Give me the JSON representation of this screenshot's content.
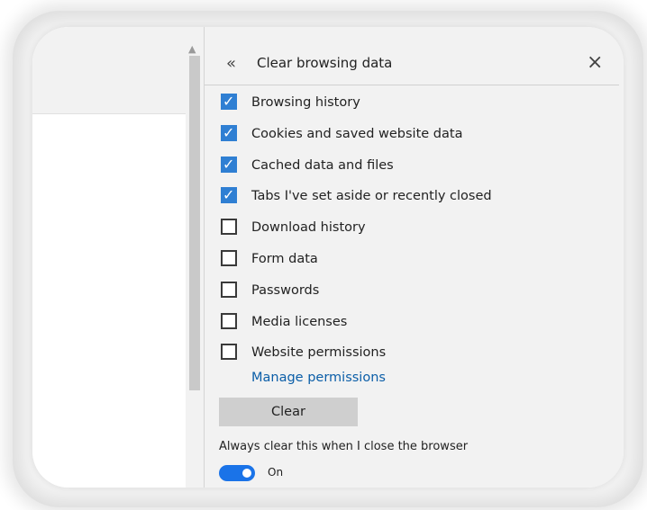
{
  "panel": {
    "title": "Clear browsing data",
    "back_icon": "«",
    "close_icon": "×",
    "options": [
      {
        "label": "Browsing history",
        "checked": true
      },
      {
        "label": "Cookies and saved website data",
        "checked": true
      },
      {
        "label": "Cached data and files",
        "checked": true
      },
      {
        "label": "Tabs I've set aside or recently closed",
        "checked": true
      },
      {
        "label": "Download history",
        "checked": false
      },
      {
        "label": "Form data",
        "checked": false
      },
      {
        "label": "Passwords",
        "checked": false
      },
      {
        "label": "Media licenses",
        "checked": false
      },
      {
        "label": "Website permissions",
        "checked": false
      }
    ],
    "manage_link": "Manage permissions",
    "clear_button": "Clear",
    "always_clear_label": "Always clear this when I close the browser",
    "toggle_state": "On",
    "toggle_on": true
  },
  "colors": {
    "accent": "#1a73e8",
    "checkbox_checked": "#2f7fd3",
    "link": "#0b5ea8"
  }
}
